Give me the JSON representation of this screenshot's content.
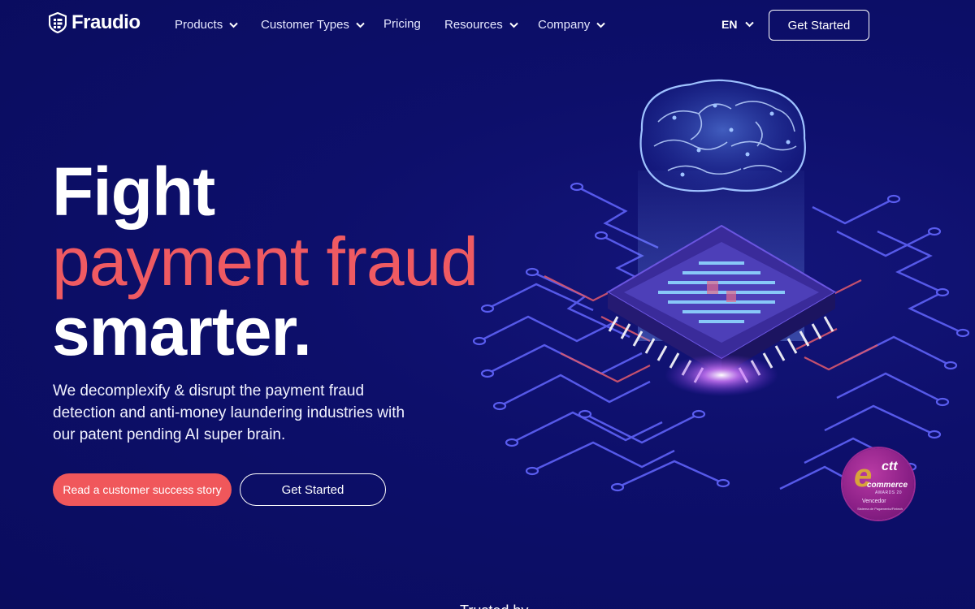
{
  "nav": {
    "brand": "Fraudio",
    "items": [
      {
        "label": "Products",
        "has_dropdown": true
      },
      {
        "label": "Customer Types",
        "has_dropdown": true
      },
      {
        "label": "Pricing",
        "has_dropdown": false
      },
      {
        "label": "Resources",
        "has_dropdown": true
      },
      {
        "label": "Company",
        "has_dropdown": true
      }
    ],
    "language": "EN",
    "cta_label": "Get Started"
  },
  "hero": {
    "headline_line1": "Fight",
    "headline_line2": "payment fraud",
    "headline_line3": "smarter.",
    "subheading": "We decomplexify & disrupt the payment fraud detection and anti-money laundering industries with our patent pending AI super brain.",
    "primary_button": "Read a customer success story",
    "secondary_button": "Get Started"
  },
  "award": {
    "brand": "ctt",
    "letter": "e",
    "title": "commerce",
    "subtitle": "AWARDS 20",
    "status": "Vencedor",
    "category": "Sistema de Pagamento/Fintech"
  },
  "trusted_by": "Trusted by",
  "colors": {
    "background": "#0d0f6b",
    "accent_red": "#ef5a62",
    "button_red": "#f0575b",
    "circuit_blue": "#5a5df0",
    "circuit_red": "#d8576e",
    "award_purple": "#8a1f86",
    "award_gold": "#d8a43a"
  },
  "icons": [
    "fraudio-logo-icon",
    "chevron-down-icon",
    "brain-illustration",
    "chip-illustration",
    "circuit-illustration"
  ]
}
